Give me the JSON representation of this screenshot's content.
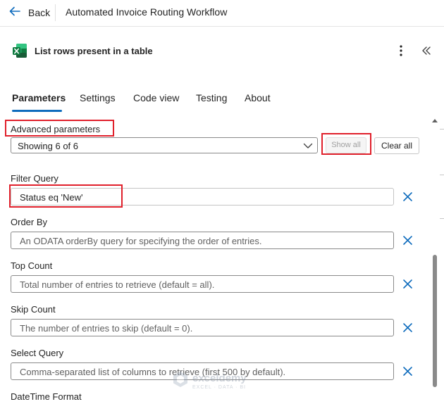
{
  "topbar": {
    "back_label": "Back",
    "flow_title": "Automated Invoice Routing Workflow"
  },
  "action": {
    "title": "List rows present in a table",
    "icon": "excel-icon"
  },
  "tabs": [
    {
      "label": "Parameters",
      "active": true
    },
    {
      "label": "Settings",
      "active": false
    },
    {
      "label": "Code view",
      "active": false
    },
    {
      "label": "Testing",
      "active": false
    },
    {
      "label": "About",
      "active": false
    }
  ],
  "advanced": {
    "label": "Advanced parameters",
    "showing": "Showing 6 of 6",
    "show_all": "Show all",
    "clear_all": "Clear all"
  },
  "fields": {
    "filter_query": {
      "label": "Filter Query",
      "value": "Status eq 'New'"
    },
    "order_by": {
      "label": "Order By",
      "placeholder": "An ODATA orderBy query for specifying the order of entries."
    },
    "top_count": {
      "label": "Top Count",
      "placeholder": "Total number of entries to retrieve (default = all)."
    },
    "skip_count": {
      "label": "Skip Count",
      "placeholder": "The number of entries to skip (default = 0)."
    },
    "select_query": {
      "label": "Select Query",
      "placeholder": "Comma-separated list of columns to retrieve (first 500 by default)."
    },
    "datetime_format": {
      "label": "DateTime Format"
    }
  },
  "watermark": {
    "name": "exceldemy",
    "sub": "EXCEL · DATA · BI"
  },
  "colors": {
    "accent": "#0f6cbd",
    "highlight": "#e0202b",
    "excel_green": "#107c41"
  }
}
